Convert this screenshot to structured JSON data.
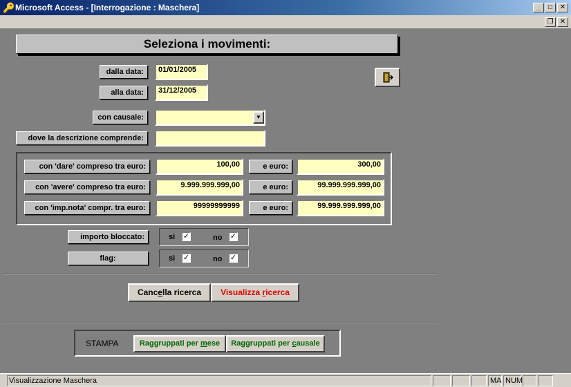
{
  "window": {
    "title": "Microsoft Access - [Interrogazione : Maschera]",
    "minimize_glyph": "_",
    "maximize_glyph": "□",
    "restore_glyph": "❐",
    "close_glyph": "✕"
  },
  "form": {
    "header": "Seleziona i movimenti:",
    "dalla_data": {
      "label": "dalla data:",
      "value": "01/01/2005"
    },
    "alla_data": {
      "label": "alla data:",
      "value": "31/12/2005"
    },
    "causale": {
      "label": "con causale:",
      "value": ""
    },
    "descrizione": {
      "label": "dove la descrizione comprende:",
      "value": ""
    },
    "ranges": [
      {
        "label": "con 'dare' compreso tra euro:",
        "from": "100,00",
        "to_label": "e euro:",
        "to": "300,00"
      },
      {
        "label": "con 'avere' compreso tra euro:",
        "from": "9.999.999.999,00",
        "to_label": "e euro:",
        "to": "99.999.999.999,00"
      },
      {
        "label": "con 'imp.nota' compr. tra euro:",
        "from": "99999999999",
        "to_label": "e euro:",
        "to": "99.999.999.999,00"
      }
    ],
    "importo_bloccato": {
      "label": "importo bloccato:",
      "si_label": "sì",
      "no_label": "no",
      "si_checked": true,
      "no_checked": true
    },
    "flag": {
      "label": "flag:",
      "si_label": "sì",
      "no_label": "no",
      "si_checked": true,
      "no_checked": true
    },
    "buttons": {
      "cancella_pre": "Canc",
      "cancella_key": "e",
      "cancella_post": "lla ricerca",
      "visualizza_pre": "Visualizza ",
      "visualizza_key": "r",
      "visualizza_post": "icerca"
    },
    "stampa": {
      "label": "STAMPA",
      "mese_pre": "Raggruppati per ",
      "mese_key": "m",
      "mese_post": "ese",
      "causale_pre": "Raggruppati per ",
      "causale_key": "c",
      "causale_post": "ausale"
    },
    "colors": {
      "field_bg": "#ffffc0",
      "visualizza_text": "#e00000",
      "stampa_buttons_text": "#006400",
      "title_bar": "#0a246a"
    }
  },
  "status": {
    "text": "Visualizzazione Maschera",
    "indicators": [
      "",
      "",
      "",
      "MA",
      "NUM",
      "",
      ""
    ]
  },
  "icons": {
    "app": "key-icon",
    "exit": "exit-door-icon",
    "dropdown": "dropdown-arrow-icon",
    "check": "checkmark-icon"
  }
}
